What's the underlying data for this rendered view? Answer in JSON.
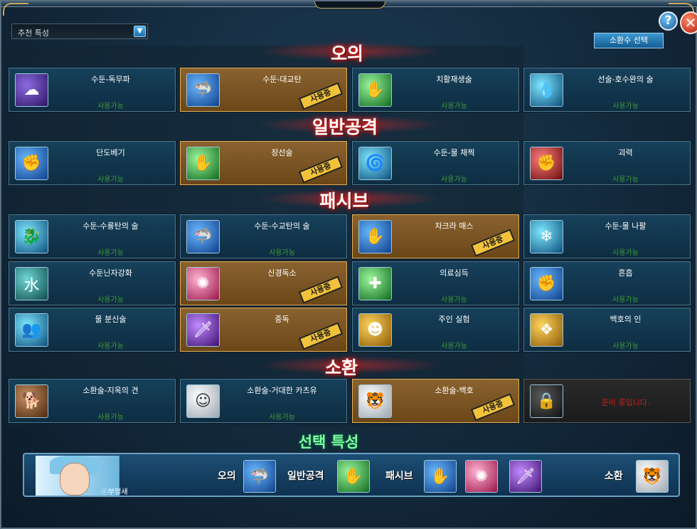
{
  "header": {
    "dropdown_label": "추천 특성",
    "summon_button": "소환수 선택",
    "help_label": "?",
    "close_label": "✕"
  },
  "sections": {
    "ougi": "오의",
    "attack": "일반공격",
    "passive": "패시브",
    "summon": "소환"
  },
  "status": {
    "available": "사용가능",
    "in_use": "사용중",
    "locked": "준비 중입니다."
  },
  "cards": {
    "ougi": [
      {
        "name": "수둔-독무파",
        "icon": "poison-mist-icon",
        "state": "available"
      },
      {
        "name": "수둔-대교탄",
        "icon": "water-shark-icon",
        "state": "in_use"
      },
      {
        "name": "치활재생술",
        "icon": "healing-hand-icon",
        "state": "available"
      },
      {
        "name": "선술-호수완의 술",
        "icon": "water-arm-icon",
        "state": "available"
      }
    ],
    "attack": [
      {
        "name": "단도베기",
        "icon": "fist-icon",
        "state": "available"
      },
      {
        "name": "장선술",
        "icon": "green-chakra-palm-icon",
        "state": "in_use"
      },
      {
        "name": "수둔-물 채찍",
        "icon": "water-whip-icon",
        "state": "available"
      },
      {
        "name": "괴력",
        "icon": "red-fist-icon",
        "state": "available"
      }
    ],
    "passive_row1": [
      {
        "name": "수둔-수룡탄의 술",
        "icon": "water-dragon-icon",
        "state": "available"
      },
      {
        "name": "수둔-수교탄의 술",
        "icon": "water-shark-small-icon",
        "state": "available"
      },
      {
        "name": "차크라 매스",
        "icon": "chakra-scalpel-icon",
        "state": "in_use"
      },
      {
        "name": "수둔-물 나팔",
        "icon": "ice-spikes-icon",
        "state": "available"
      }
    ],
    "passive_row2": [
      {
        "name": "수둔닌자강화",
        "icon": "water-kanji-icon",
        "state": "available"
      },
      {
        "name": "신경독소",
        "icon": "brain-toxin-icon",
        "state": "in_use"
      },
      {
        "name": "의료심득",
        "icon": "medical-scroll-icon",
        "state": "available"
      },
      {
        "name": "흔흡",
        "icon": "chakra-grip-icon",
        "state": "available"
      }
    ],
    "passive_row3": [
      {
        "name": "물 분신술",
        "icon": "water-clone-icon",
        "state": "available"
      },
      {
        "name": "중독",
        "icon": "poison-blade-icon",
        "state": "in_use"
      },
      {
        "name": "주인 실험",
        "icon": "tiger-face-icon",
        "state": "available"
      },
      {
        "name": "백호의 인",
        "icon": "white-tiger-seal-icon",
        "state": "available"
      }
    ],
    "summon": [
      {
        "name": "소환술-지옥의 견",
        "icon": "hell-hound-icon",
        "state": "available"
      },
      {
        "name": "소환술-거대한 카츠유",
        "icon": "katsuyu-slug-icon",
        "state": "available"
      },
      {
        "name": "소환술-백호",
        "icon": "white-tiger-icon",
        "state": "in_use"
      },
      {
        "name": "",
        "icon": "padlock-icon",
        "state": "locked"
      }
    ]
  },
  "selected": {
    "title": "선택 특성",
    "copyright": "ⓒ부엉새",
    "ougi_label": "오의",
    "attack_label": "일반공격",
    "passive_label": "패시브",
    "summon_label": "소환"
  },
  "colors": {
    "available_text": "#3f9a38",
    "used_card": "#8a6230",
    "stamp": "#f2c23a",
    "locked_text": "#c81e1e",
    "selected_title": "#7dffa0"
  }
}
